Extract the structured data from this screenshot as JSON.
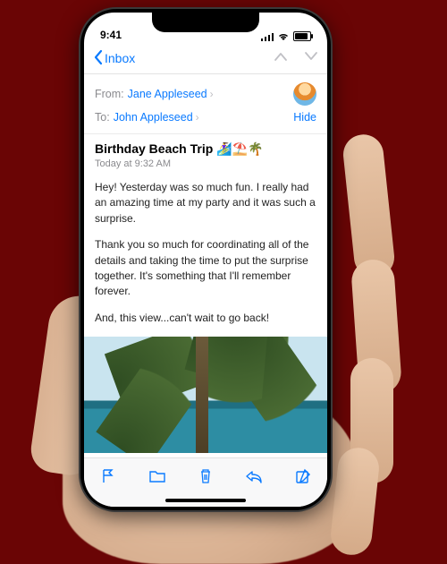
{
  "status": {
    "time": "9:41"
  },
  "nav": {
    "back_label": "Inbox"
  },
  "headers": {
    "from_label": "From:",
    "from_name": "Jane Appleseed",
    "to_label": "To:",
    "to_name": "John Appleseed",
    "hide_label": "Hide"
  },
  "subject": {
    "title": "Birthday Beach Trip 🏄‍♀️⛱️🌴",
    "date": "Today at 9:32 AM"
  },
  "body": {
    "p1": "Hey! Yesterday was so much fun. I really had an amazing time at my party and it was such a surprise.",
    "p2": "Thank you so much for coordinating all of the details and taking the time to put the surprise together. It's something that I'll remember forever.",
    "p3": "And, this view...can't wait to go back!"
  }
}
